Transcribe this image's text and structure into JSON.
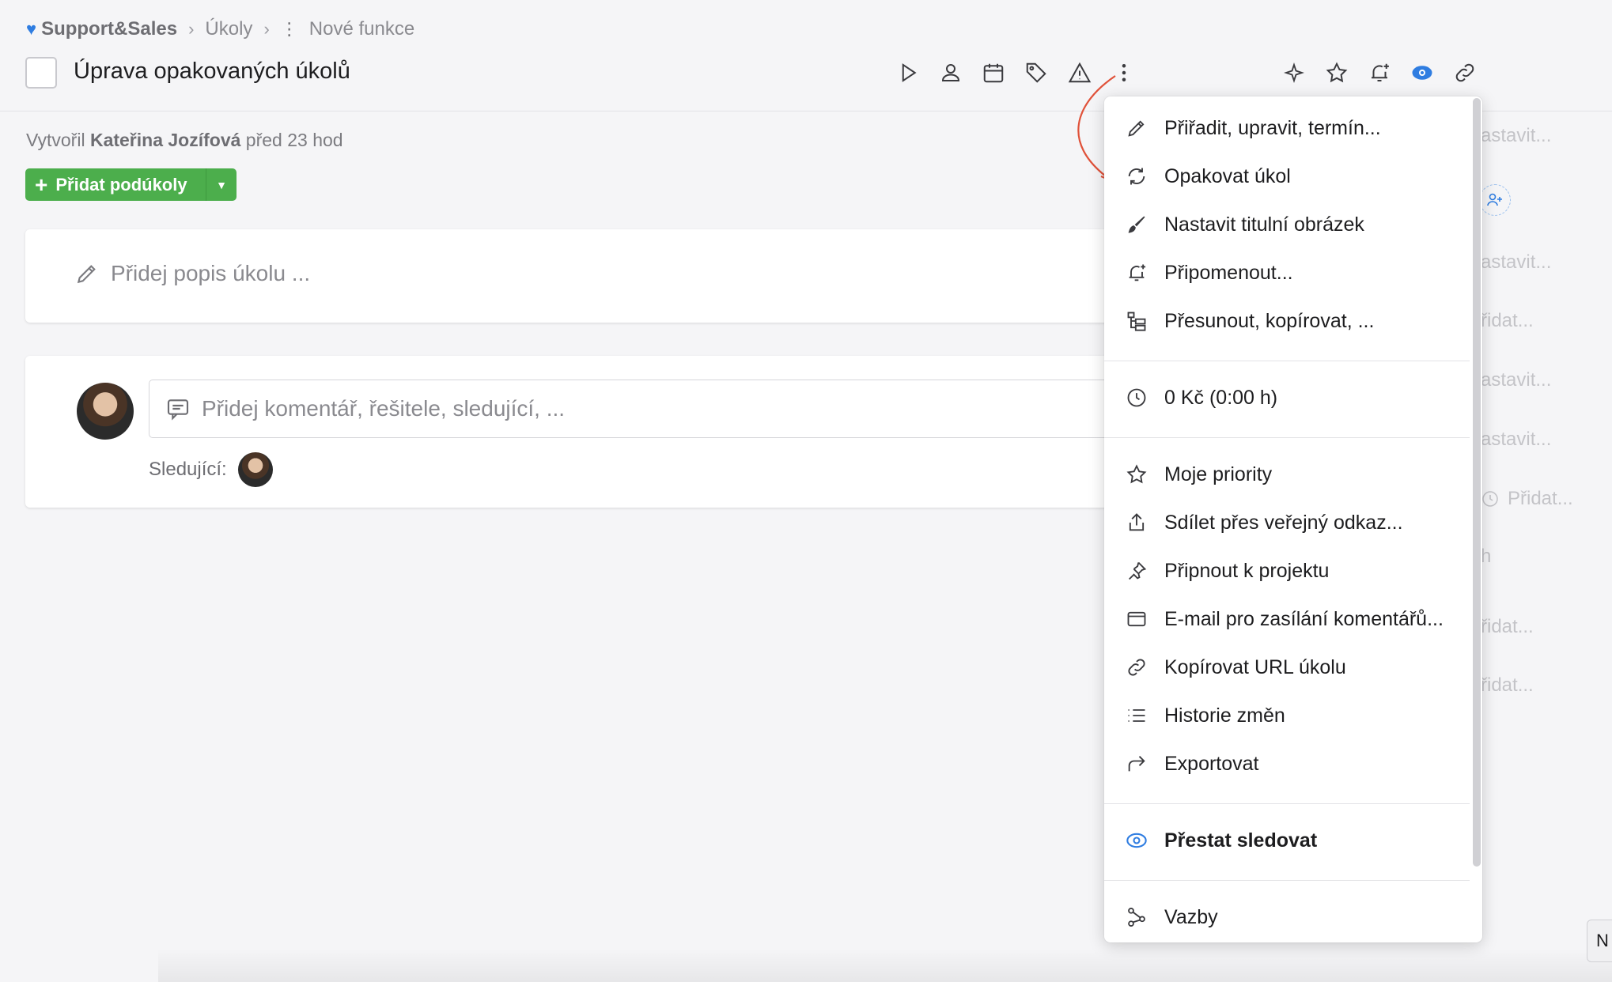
{
  "breadcrumb": {
    "workspace": "Support&Sales",
    "tasks": "Úkoly",
    "section": "Nové funkce"
  },
  "task": {
    "title": "Úprava opakovaných úkolů"
  },
  "meta": {
    "created_prefix": "Vytvořil",
    "author": "Kateřina Jozífová",
    "when": "před 23 hod"
  },
  "subtasks": {
    "button_label": "Přidat podúkoly"
  },
  "description": {
    "placeholder": "Přidej popis úkolu ..."
  },
  "comments": {
    "placeholder": "Přidej komentář, řešitele, sledující, ...",
    "followers_label": "Sledující:"
  },
  "background_right": {
    "r1": "astavit...",
    "r2": "astavit...",
    "r3": "řidat...",
    "r4": "astavit...",
    "r5": "astavit...",
    "r6": "Přidat...",
    "r7": "h",
    "r8": "řidat...",
    "r9": "řidat..."
  },
  "menu": {
    "assign": "Přiřadit, upravit, termín...",
    "repeat": "Opakovat úkol",
    "cover": "Nastavit titulní obrázek",
    "remind": "Připomenout...",
    "move": "Přesunout, kopírovat, ...",
    "cost": "0 Kč (0:00 h)",
    "priorities": "Moje priority",
    "share": "Sdílet přes veřejný odkaz...",
    "pin": "Připnout k projektu",
    "email": "E-mail pro zasílání komentářů...",
    "copy_url": "Kopírovat URL úkolu",
    "history": "Historie změn",
    "export": "Exportovat",
    "unfollow": "Přestat sledovat",
    "links": "Vazby"
  },
  "corner": {
    "label": "N"
  },
  "colors": {
    "accent_blue": "#2f7de1",
    "green": "#4cae4c",
    "arrow_red": "#e0523a"
  }
}
